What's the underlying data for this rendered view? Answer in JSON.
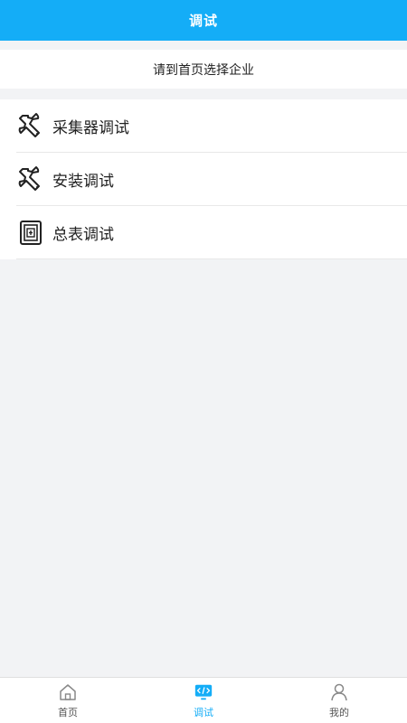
{
  "header": {
    "title": "调试"
  },
  "notice": {
    "text": "请到首页选择企业"
  },
  "menu": {
    "items": [
      {
        "label": "采集器调试",
        "icon": "wrench-icon"
      },
      {
        "label": "安装调试",
        "icon": "wrench-icon"
      },
      {
        "label": "总表调试",
        "icon": "meter-icon"
      }
    ]
  },
  "tabbar": {
    "items": [
      {
        "label": "首页",
        "icon": "home-icon"
      },
      {
        "label": "调试",
        "icon": "code-icon",
        "active": true
      },
      {
        "label": "我的",
        "icon": "user-icon"
      }
    ],
    "active_color": "#14adf7"
  },
  "colors": {
    "header": "#14adf7",
    "background": "#f2f3f5"
  }
}
